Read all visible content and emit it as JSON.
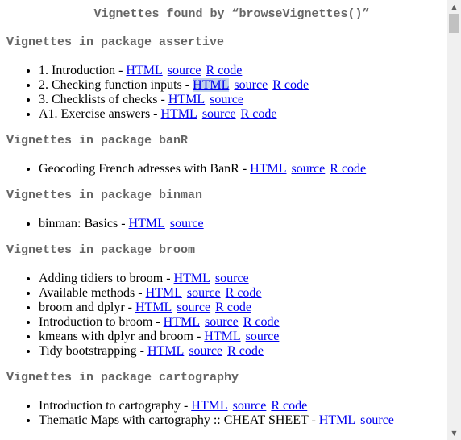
{
  "page": {
    "title": "Vignettes found by “browseVignettes()”"
  },
  "link_labels": {
    "html": "HTML",
    "source": "source",
    "rcode": "R code"
  },
  "sections": [
    {
      "heading": "Vignettes in package assertive",
      "items": [
        {
          "text": "1. Introduction - ",
          "links": [
            "html",
            "source",
            "rcode"
          ]
        },
        {
          "text": "2. Checking function inputs - ",
          "links": [
            "html",
            "source",
            "rcode"
          ],
          "selected_link": "html"
        },
        {
          "text": "3. Checklists of checks - ",
          "links": [
            "html",
            "source"
          ]
        },
        {
          "text": "A1. Exercise answers - ",
          "links": [
            "html",
            "source",
            "rcode"
          ]
        }
      ]
    },
    {
      "heading": "Vignettes in package banR",
      "items": [
        {
          "text": "Geocoding French adresses with BanR - ",
          "links": [
            "html",
            "source",
            "rcode"
          ]
        }
      ]
    },
    {
      "heading": "Vignettes in package binman",
      "items": [
        {
          "text": "binman: Basics - ",
          "links": [
            "html",
            "source"
          ]
        }
      ]
    },
    {
      "heading": "Vignettes in package broom",
      "items": [
        {
          "text": "Adding tidiers to broom - ",
          "links": [
            "html",
            "source"
          ]
        },
        {
          "text": "Available methods - ",
          "links": [
            "html",
            "source",
            "rcode"
          ]
        },
        {
          "text": "broom and dplyr - ",
          "links": [
            "html",
            "source",
            "rcode"
          ]
        },
        {
          "text": "Introduction to broom - ",
          "links": [
            "html",
            "source",
            "rcode"
          ]
        },
        {
          "text": "kmeans with dplyr and broom - ",
          "links": [
            "html",
            "source"
          ]
        },
        {
          "text": "Tidy bootstrapping - ",
          "links": [
            "html",
            "source",
            "rcode"
          ]
        }
      ]
    },
    {
      "heading": "Vignettes in package cartography",
      "items": [
        {
          "text": "Introduction to cartography - ",
          "links": [
            "html",
            "source",
            "rcode"
          ]
        },
        {
          "text": "Thematic Maps with cartography :: CHEAT SHEET - ",
          "links": [
            "html",
            "source"
          ]
        }
      ]
    }
  ],
  "scrollbar": {
    "up_icon": "scroll-up-arrow-icon",
    "down_icon": "scroll-down-arrow-icon",
    "position_fraction": 0.0
  }
}
